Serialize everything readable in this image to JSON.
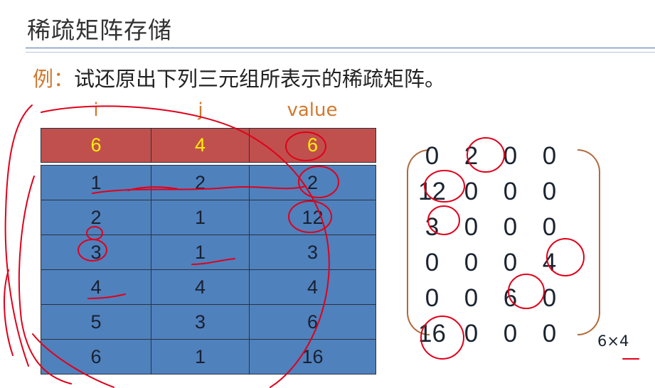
{
  "title": "稀疏矩阵存储",
  "example": {
    "lead": "例：",
    "text": "试还原出下列三元组所表示的稀疏矩阵。"
  },
  "triple_table": {
    "columns": [
      "i",
      "j",
      "value"
    ],
    "header_row": [
      "6",
      "4",
      "6"
    ],
    "rows": [
      [
        "1",
        "2",
        "2"
      ],
      [
        "2",
        "1",
        "12"
      ],
      [
        "3",
        "1",
        "3"
      ],
      [
        "4",
        "4",
        "4"
      ],
      [
        "5",
        "3",
        "6"
      ],
      [
        "6",
        "1",
        "16"
      ]
    ]
  },
  "matrix": {
    "rows": [
      [
        "0",
        "2",
        "0",
        "0"
      ],
      [
        "12",
        "0",
        "0",
        "0"
      ],
      [
        "3",
        "0",
        "0",
        "0"
      ],
      [
        "0",
        "0",
        "0",
        "4"
      ],
      [
        "0",
        "0",
        "6",
        "0"
      ],
      [
        "16",
        "0",
        "0",
        "0"
      ]
    ],
    "dimensions": "6×4"
  },
  "colors": {
    "header_fill": "#c0504d",
    "header_text": "#ffef00",
    "body_fill": "#4f81bd",
    "column_label": "#d2792e",
    "annotation_ink": "#e0001a",
    "bracket": "#b06a3a"
  }
}
